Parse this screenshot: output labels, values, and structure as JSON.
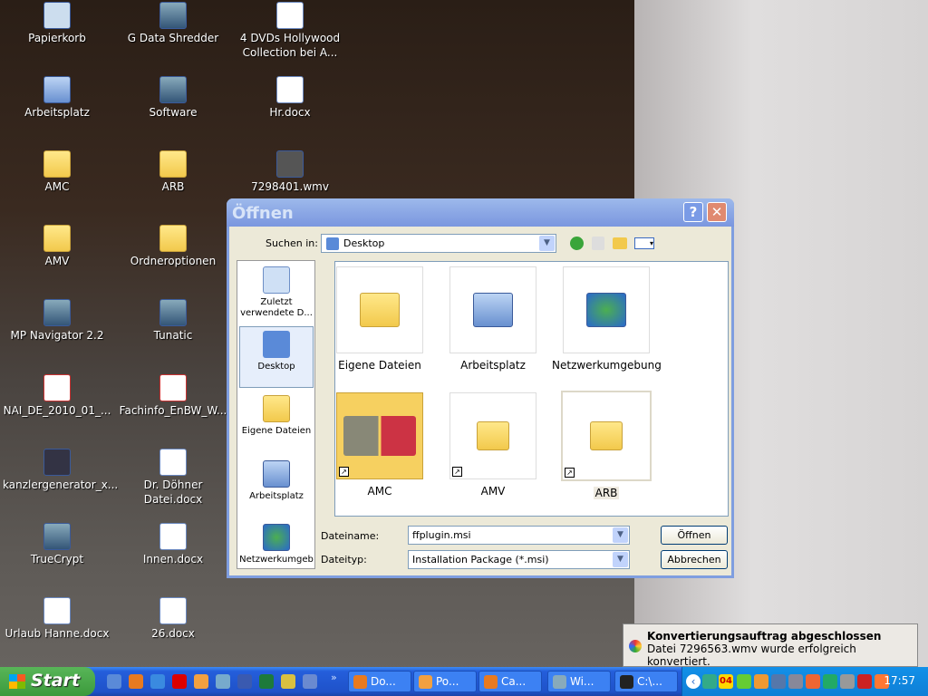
{
  "desktop_icons": [
    {
      "label": "Papierkorb",
      "type": "recycle"
    },
    {
      "label": "G Data Shredder",
      "type": "app"
    },
    {
      "label": "4 DVDs Hollywood Collection bei A...",
      "type": "doc"
    },
    {
      "label": "Arbeitsplatz",
      "type": "pc"
    },
    {
      "label": "Software",
      "type": "app"
    },
    {
      "label": "Hr.docx",
      "type": "doc"
    },
    {
      "label": "AMC",
      "type": "folder"
    },
    {
      "label": "ARB",
      "type": "folder"
    },
    {
      "label": "7298401.wmv",
      "type": "video"
    },
    {
      "label": "AMV",
      "type": "folder"
    },
    {
      "label": "Ordneroptionen",
      "type": "folder"
    },
    {
      "label": "MP Navigator 2.2",
      "type": "app"
    },
    {
      "label": "Tunatic",
      "type": "app"
    },
    {
      "label": "NAI_DE_2010_01_...",
      "type": "pdf"
    },
    {
      "label": "Fachinfo_EnBW_W...",
      "type": "pdf"
    },
    {
      "label": "kanzlergenerator_x...",
      "type": "flash"
    },
    {
      "label": "Dr. Döhner Datei.docx",
      "type": "doc"
    },
    {
      "label": "TrueCrypt",
      "type": "app"
    },
    {
      "label": "Innen.docx",
      "type": "doc"
    },
    {
      "label": "Urlaub Hanne.docx",
      "type": "doc"
    },
    {
      "label": "26.docx",
      "type": "doc"
    }
  ],
  "dialog": {
    "title": "Öffnen",
    "help": "?",
    "close": "✕",
    "look_in_label": "Suchen in:",
    "look_in_value": "Desktop",
    "places": [
      "Zuletzt verwendete D...",
      "Desktop",
      "Eigene Dateien",
      "Arbeitsplatz",
      "Netzwerkumgeb"
    ],
    "items": [
      {
        "label": "Eigene Dateien",
        "type": "folder"
      },
      {
        "label": "Arbeitsplatz",
        "type": "pc"
      },
      {
        "label": "Netzwerkumgebung",
        "type": "network"
      },
      {
        "label": "AMC",
        "type": "folder-shortcut"
      },
      {
        "label": "AMV",
        "type": "folder-shortcut"
      },
      {
        "label": "ARB",
        "type": "folder-shortcut"
      }
    ],
    "filename_label": "Dateiname:",
    "filename_value": "ffplugin.msi",
    "filetype_label": "Dateityp:",
    "filetype_value": "Installation Package (*.msi)",
    "open_button": "Öffnen",
    "cancel_button": "Abbrechen"
  },
  "balloon": {
    "title": "Konvertierungsauftrag abgeschlossen",
    "message": "Datei 7296563.wmv wurde erfolgreich konvertiert."
  },
  "taskbar": {
    "start": "Start",
    "quicklaunch": [
      "desktop",
      "firefox",
      "internet-explorer",
      "opera",
      "thunderbird",
      "messenger",
      "word",
      "excel",
      "chart",
      "tool"
    ],
    "more": "»",
    "tasks": [
      "Do...",
      "Po...",
      "Ca...",
      "Wi...",
      "C:\\..."
    ],
    "tray_date": "04",
    "clock": "17:57"
  }
}
